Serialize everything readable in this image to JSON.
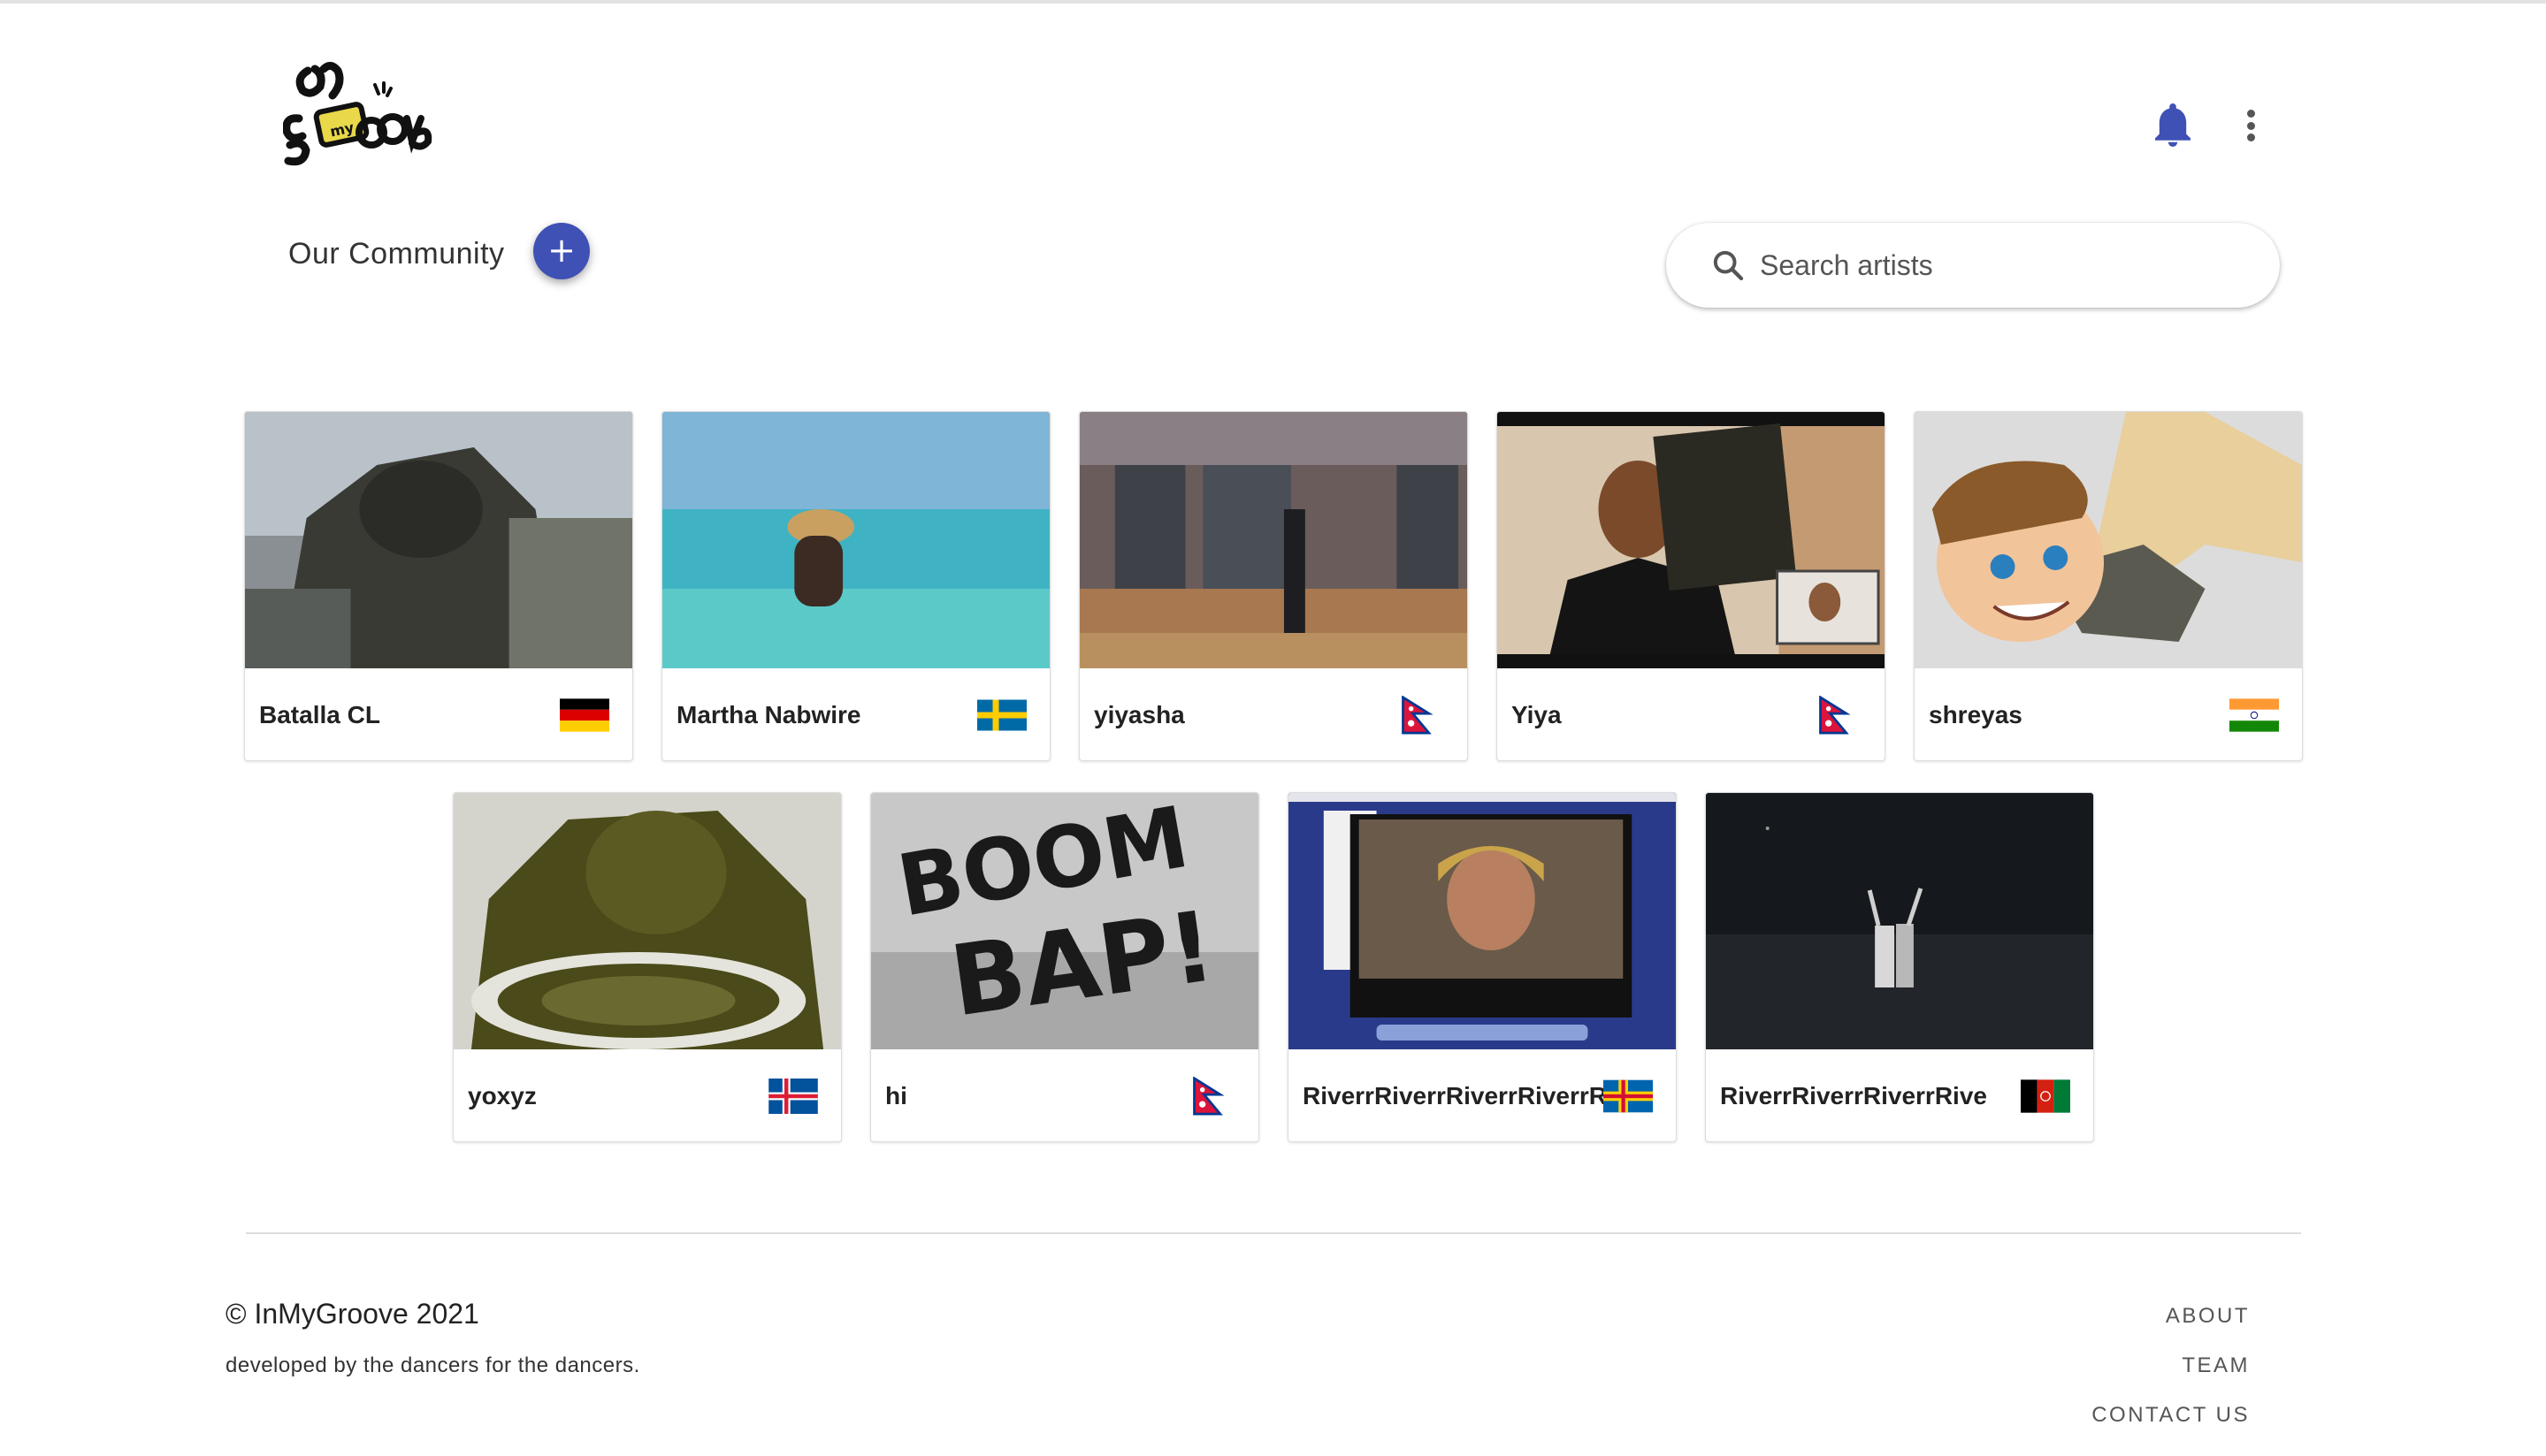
{
  "header": {
    "logo_name": "InMyGroove logo",
    "notification_icon": "bell-icon",
    "menu_icon": "more-vert-icon"
  },
  "community": {
    "title": "Our Community",
    "add_label": "+"
  },
  "search": {
    "placeholder": "Search artists",
    "icon": "search-icon"
  },
  "artists": [
    {
      "name": "Batalla CL",
      "flag": "Germany"
    },
    {
      "name": "Martha Nabwire",
      "flag": "Sweden"
    },
    {
      "name": "yiyasha",
      "flag": "Nepal"
    },
    {
      "name": "Yiya",
      "flag": "Nepal"
    },
    {
      "name": "shreyas",
      "flag": "India"
    },
    {
      "name": "yoxyz",
      "flag": "Iceland"
    },
    {
      "name": "hi",
      "flag": "Nepal"
    },
    {
      "name": "RiverrRiverrRiverrRiverrR",
      "flag": "Aland Islands"
    },
    {
      "name": "RiverrRiverrRiverrRive",
      "flag": "Afghanistan"
    }
  ],
  "footer": {
    "copyright": "© InMyGroove 2021",
    "tagline": "developed by the dancers for the dancers.",
    "links": [
      "ABOUT",
      "TEAM",
      "CONTACT US"
    ]
  },
  "colors": {
    "accent": "#3f51b5",
    "bell": "#3f51b5",
    "divider": "#dcdcdc"
  }
}
